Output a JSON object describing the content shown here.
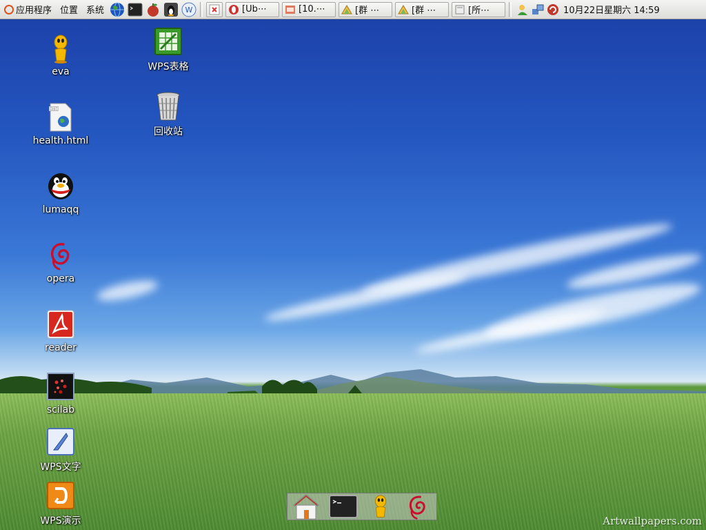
{
  "panel": {
    "menus": [
      "应用程序",
      "位置",
      "系统"
    ],
    "launchers": [
      {
        "icon": "globe-icon"
      },
      {
        "icon": "terminal-icon"
      },
      {
        "icon": "apple-icon"
      },
      {
        "icon": "penguin-icon"
      },
      {
        "icon": "wps-icon"
      }
    ],
    "tasks": [
      {
        "icon": "close-box-icon",
        "label": ""
      },
      {
        "icon": "opera-icon",
        "label": "[Ub⋯"
      },
      {
        "icon": "screenshot-icon",
        "label": "[10.⋯"
      },
      {
        "icon": "group-chat-icon",
        "label": "[群 ⋯"
      },
      {
        "icon": "group-chat-icon",
        "label": "[群 ⋯"
      },
      {
        "icon": "file-icon",
        "label": "[所⋯"
      }
    ],
    "tray": [
      {
        "icon": "buddy-icon"
      },
      {
        "icon": "network-icon"
      },
      {
        "icon": "update-icon"
      }
    ],
    "clock": "10月22日星期六 14:59"
  },
  "desktop_icons": [
    {
      "label": "eva",
      "icon": "eva-penguin-icon"
    },
    {
      "label": "health.html",
      "icon": "html-file-icon"
    },
    {
      "label": "lumaqq",
      "icon": "qq-penguin-icon"
    },
    {
      "label": "opera",
      "icon": "debian-swirl-icon"
    },
    {
      "label": "reader",
      "icon": "pdf-reader-icon"
    },
    {
      "label": "scilab",
      "icon": "scilab-icon"
    },
    {
      "label": "WPS文字",
      "icon": "wps-writer-icon"
    },
    {
      "label": "WPS演示",
      "icon": "wps-presentation-icon"
    },
    {
      "label": "WPS表格",
      "icon": "wps-spreadsheet-icon"
    },
    {
      "label": "回收站",
      "icon": "trash-icon"
    }
  ],
  "dock": [
    {
      "icon": "home-icon"
    },
    {
      "icon": "terminal-icon"
    },
    {
      "icon": "eva-penguin-icon"
    },
    {
      "icon": "debian-swirl-icon"
    }
  ],
  "watermark": "Artwallpapers.com"
}
